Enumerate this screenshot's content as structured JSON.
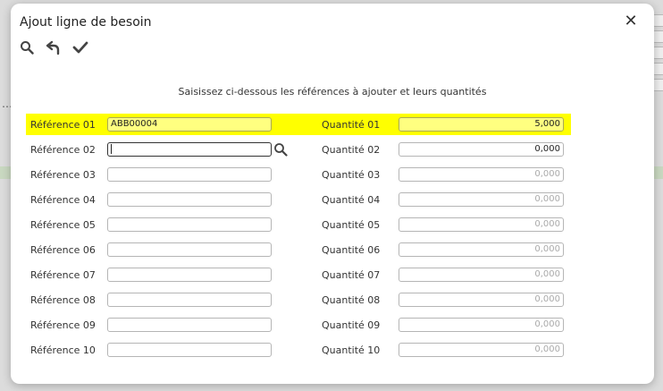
{
  "dialog": {
    "title": "Ajout ligne de besoin",
    "close_glyph": "✕",
    "instruction": "Saisissez ci-dessous les références à ajouter et leurs quantités"
  },
  "toolbar": {
    "icons": [
      "search-icon",
      "undo-icon",
      "check-icon"
    ]
  },
  "rows": [
    {
      "ref_label": "Référence 01",
      "ref_value": "ABB00004",
      "qty_label": "Quantité 01",
      "qty_value": "5,000"
    },
    {
      "ref_label": "Référence 02",
      "ref_value": "",
      "qty_label": "Quantité 02",
      "qty_value": "0,000"
    },
    {
      "ref_label": "Référence 03",
      "ref_value": "",
      "qty_label": "Quantité 03",
      "qty_value": "0,000"
    },
    {
      "ref_label": "Référence 04",
      "ref_value": "",
      "qty_label": "Quantité 04",
      "qty_value": "0,000"
    },
    {
      "ref_label": "Référence 05",
      "ref_value": "",
      "qty_label": "Quantité 05",
      "qty_value": "0,000"
    },
    {
      "ref_label": "Référence 06",
      "ref_value": "",
      "qty_label": "Quantité 06",
      "qty_value": "0,000"
    },
    {
      "ref_label": "Référence 07",
      "ref_value": "",
      "qty_label": "Quantité 07",
      "qty_value": "0,000"
    },
    {
      "ref_label": "Référence 08",
      "ref_value": "",
      "qty_label": "Quantité 08",
      "qty_value": "0,000"
    },
    {
      "ref_label": "Référence 09",
      "ref_value": "",
      "qty_label": "Quantité 09",
      "qty_value": "0,000"
    },
    {
      "ref_label": "Référence 10",
      "ref_value": "",
      "qty_label": "Quantité 10",
      "qty_value": "0,000"
    }
  ],
  "colors": {
    "highlight": "#ffff00",
    "highlight_input": "#ffff80"
  }
}
